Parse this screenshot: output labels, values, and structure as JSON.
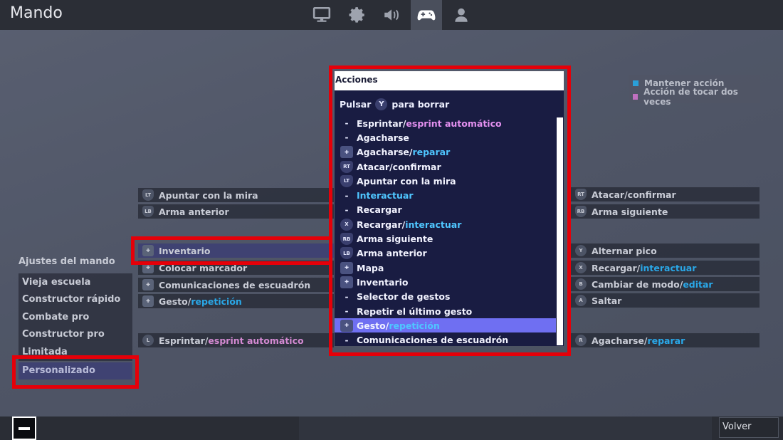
{
  "header": {
    "title": "Mando",
    "tabs": [
      {
        "name": "video",
        "icon": "monitor-icon"
      },
      {
        "name": "game",
        "icon": "gear-icon"
      },
      {
        "name": "audio",
        "icon": "speaker-icon"
      },
      {
        "name": "controller",
        "icon": "gamepad-icon",
        "active": true
      },
      {
        "name": "account",
        "icon": "user-icon"
      }
    ]
  },
  "legend": {
    "hold": "Mantener acción",
    "double_tap": "Acción de tocar dos veces",
    "hold_color": "#2a9fd8",
    "double_tap_color": "#c070c0"
  },
  "left_mappings": [
    {
      "button": "LT",
      "icon": "left-trigger-icon",
      "label": "Apuntar con la mira",
      "alt": ""
    },
    {
      "button": "LB",
      "icon": "left-bumper-icon",
      "label": "Arma anterior",
      "alt": ""
    },
    {
      "button": "",
      "icon": "dpad-up-icon",
      "label": "Inventario",
      "alt": ""
    },
    {
      "button": "",
      "icon": "dpad-left-icon",
      "label": "Colocar marcador",
      "alt": ""
    },
    {
      "button": "",
      "icon": "dpad-right-icon",
      "label": "Comunicaciones de escuadrón",
      "alt": ""
    },
    {
      "button": "",
      "icon": "dpad-down-icon",
      "label": "Gesto/",
      "alt": "repetición"
    },
    {
      "button": "L",
      "icon": "left-stick-icon",
      "label": "Esprintar/",
      "alt": "esprint automático"
    }
  ],
  "right_mappings": [
    {
      "button": "RT",
      "icon": "right-trigger-icon",
      "label": "Atacar/confirmar",
      "alt": ""
    },
    {
      "button": "RB",
      "icon": "right-bumper-icon",
      "label": "Arma siguiente",
      "alt": ""
    },
    {
      "button": "Y",
      "icon": "y-button-icon",
      "label": "Alternar pico",
      "alt": ""
    },
    {
      "button": "X",
      "icon": "x-button-icon",
      "label": "Recargar/",
      "alt": "interactuar"
    },
    {
      "button": "B",
      "icon": "b-button-icon",
      "label": "Cambiar de modo/",
      "alt": "editar"
    },
    {
      "button": "A",
      "icon": "a-button-icon",
      "label": "Saltar",
      "alt": ""
    },
    {
      "button": "R",
      "icon": "right-stick-icon",
      "label": "Agacharse/",
      "alt": "reparar"
    }
  ],
  "settings": {
    "title": "Ajustes del mando",
    "items": [
      "Vieja escuela",
      "Constructor rápido",
      "Combate pro",
      "Constructor pro",
      "Limitada",
      "Personalizado"
    ],
    "selected": "Personalizado"
  },
  "actions": {
    "header": "Acciones",
    "hint_prefix": "Pulsar",
    "hint_button": "Y",
    "hint_suffix": "para borrar",
    "items": [
      {
        "icon": "dash",
        "badge": "-",
        "label": "Esprintar/",
        "alt": "esprint automático",
        "alt_type": "pink"
      },
      {
        "icon": "dash",
        "badge": "-",
        "label": "Agacharse",
        "alt": "",
        "alt_type": ""
      },
      {
        "icon": "dpad",
        "badge": "✚",
        "label": "Agacharse/",
        "alt": "reparar",
        "alt_type": "cyan"
      },
      {
        "icon": "shield",
        "badge": "RT",
        "label": "Atacar/confirmar",
        "alt": "",
        "alt_type": ""
      },
      {
        "icon": "shield",
        "badge": "LT",
        "label": "Apuntar con la mira",
        "alt": "",
        "alt_type": ""
      },
      {
        "icon": "dash",
        "badge": "-",
        "label": "",
        "alt": "Interactuar",
        "alt_type": "cyan"
      },
      {
        "icon": "dash",
        "badge": "-",
        "label": "Recargar",
        "alt": "",
        "alt_type": ""
      },
      {
        "icon": "circle",
        "badge": "X",
        "label": "Recargar/",
        "alt": "interactuar",
        "alt_type": "cyan"
      },
      {
        "icon": "shield",
        "badge": "RB",
        "label": "Arma siguiente",
        "alt": "",
        "alt_type": ""
      },
      {
        "icon": "shield",
        "badge": "LB",
        "label": "Arma anterior",
        "alt": "",
        "alt_type": ""
      },
      {
        "icon": "dpad",
        "badge": "✚",
        "label": "Mapa",
        "alt": "",
        "alt_type": ""
      },
      {
        "icon": "dpad",
        "badge": "✚",
        "label": "Inventario",
        "alt": "",
        "alt_type": ""
      },
      {
        "icon": "dash",
        "badge": "-",
        "label": "Selector de gestos",
        "alt": "",
        "alt_type": ""
      },
      {
        "icon": "dash",
        "badge": "-",
        "label": "Repetir el último gesto",
        "alt": "",
        "alt_type": ""
      },
      {
        "icon": "dpad",
        "badge": "✚",
        "label": "Gesto/",
        "alt": "repetición",
        "alt_type": "cyan",
        "selected": true
      },
      {
        "icon": "dash",
        "badge": "-",
        "label": "Comunicaciones de escuadrón",
        "alt": "",
        "alt_type": ""
      }
    ]
  },
  "footer": {
    "back_label": "Volver",
    "minus_icon": "minus-button-icon"
  }
}
